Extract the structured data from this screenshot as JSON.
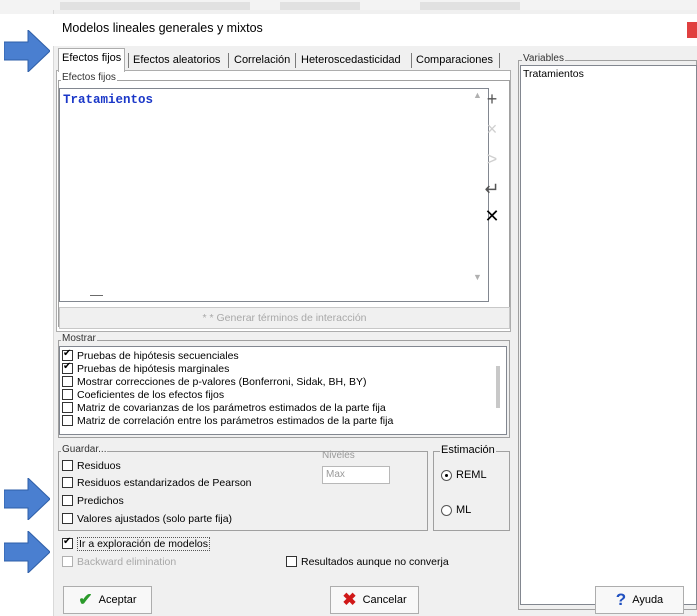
{
  "window": {
    "title": "Modelos lineales generales y mixtos"
  },
  "tabs": [
    {
      "label": "Efectos fijos",
      "active": true
    },
    {
      "label": "Efectos aleatorios",
      "active": false
    },
    {
      "label": "Correlación",
      "active": false
    },
    {
      "label": "Heteroscedasticidad",
      "active": false
    },
    {
      "label": "Comparaciones",
      "active": false
    }
  ],
  "efectos_fijos": {
    "group_label": "Efectos fijos",
    "items": [
      "Tratamientos"
    ],
    "interaction_button": "* * Generar términos de interacción",
    "side_buttons": [
      {
        "icon": "plus-icon",
        "glyph": "+"
      },
      {
        "icon": "multiply-icon",
        "glyph": "×"
      },
      {
        "icon": "chevron-right-icon",
        "glyph": ">"
      },
      {
        "icon": "return-icon",
        "glyph": "↵"
      },
      {
        "icon": "delete-icon",
        "glyph": "✕"
      }
    ],
    "minus_glyph": "—"
  },
  "variables": {
    "label": "Variables",
    "items": [
      "Tratamientos"
    ]
  },
  "mostrar": {
    "label": "Mostrar",
    "options": [
      {
        "label": "Pruebas de hipótesis secuenciales",
        "checked": true
      },
      {
        "label": "Pruebas de hipótesis marginales",
        "checked": true
      },
      {
        "label": "Mostrar correcciones de p-valores (Bonferroni, Sidak, BH, BY)",
        "checked": false
      },
      {
        "label": "Coeficientes de los efectos fijos",
        "checked": false
      },
      {
        "label": "Matriz de covarianzas de los parámetros estimados de la parte fija",
        "checked": false
      },
      {
        "label": "Matriz de correlación entre los parámetros estimados de la parte fija",
        "checked": false
      }
    ]
  },
  "guardar": {
    "label": "Guardar...",
    "niveles_label": "Niveles",
    "niveles_value": "Max",
    "options": [
      {
        "label": "Residuos",
        "checked": false
      },
      {
        "label": "Residuos estandarizados de Pearson",
        "checked": false
      },
      {
        "label": "Predichos",
        "checked": false
      },
      {
        "label": "Valores ajustados (solo parte fija)",
        "checked": false
      }
    ]
  },
  "estimacion": {
    "label": "Estimación",
    "options": [
      {
        "label": "REML",
        "selected": true
      },
      {
        "label": "ML",
        "selected": false
      }
    ]
  },
  "extras": {
    "ir_exploracion": {
      "label": "Ir a exploración de modelos",
      "checked": true
    },
    "backward": {
      "label": "Backward elimination",
      "checked": false,
      "disabled": true
    },
    "resultados": {
      "label": "Resultados aunque no converja",
      "checked": false
    }
  },
  "buttons": {
    "aceptar": "Aceptar",
    "cancelar": "Cancelar",
    "ayuda": "Ayuda"
  },
  "colors": {
    "arrow": "#4a7fd0",
    "accent_text": "#1a37c8",
    "check_green": "#2a9a2a",
    "cancel_red": "#d01818",
    "help_blue": "#2050c0"
  }
}
